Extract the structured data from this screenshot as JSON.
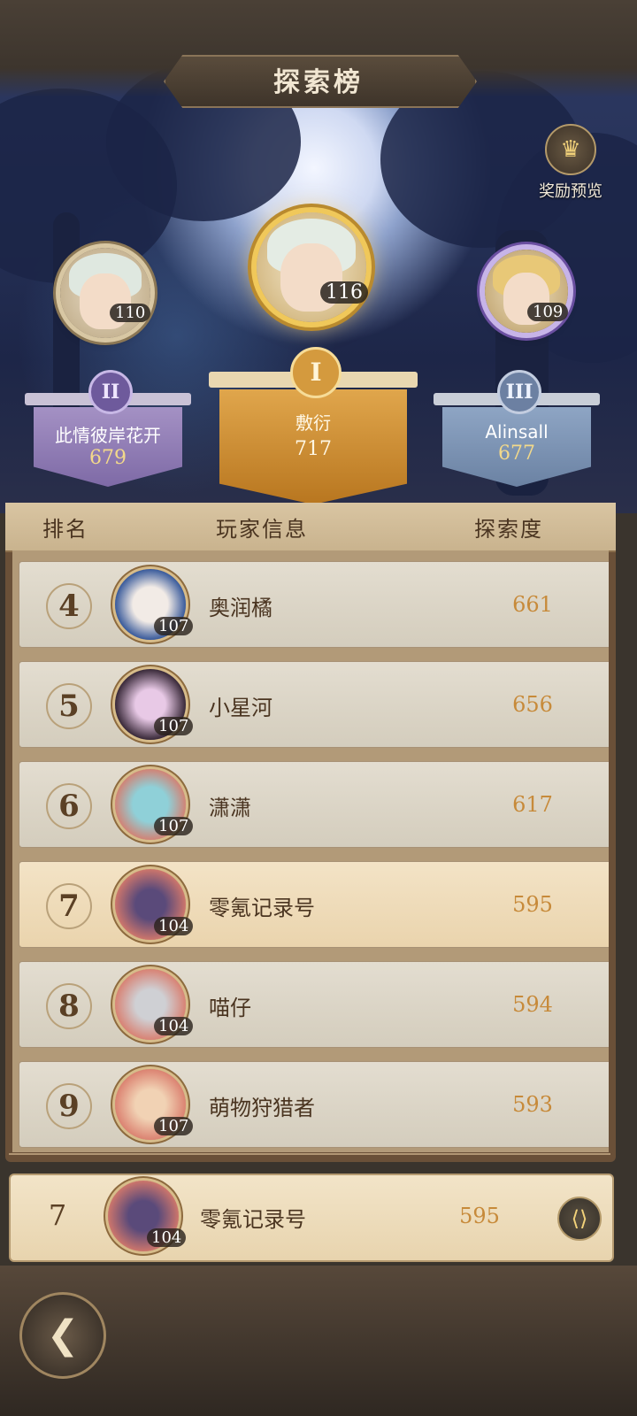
{
  "title": "探索榜",
  "reward_preview": {
    "label": "奖励预览",
    "icon": "reward-chest-icon"
  },
  "top3": [
    {
      "rank": "I",
      "name": "敷衍",
      "score": "717",
      "level": "116"
    },
    {
      "rank": "II",
      "name": "此情彼岸花开",
      "score": "679",
      "level": "110"
    },
    {
      "rank": "III",
      "name": "Alinsall",
      "score": "677",
      "level": "109"
    }
  ],
  "table_header": {
    "rank": "排名",
    "player": "玩家信息",
    "explore": "探索度"
  },
  "rows": [
    {
      "rank": "4",
      "name": "奥润橘",
      "score": "661",
      "level": "107"
    },
    {
      "rank": "5",
      "name": "小星河",
      "score": "656",
      "level": "107"
    },
    {
      "rank": "6",
      "name": "潇潇",
      "score": "617",
      "level": "107"
    },
    {
      "rank": "7",
      "name": "零氪记录号",
      "score": "595",
      "level": "104"
    },
    {
      "rank": "8",
      "name": "喵仔",
      "score": "594",
      "level": "104"
    },
    {
      "rank": "9",
      "name": "萌物狩猎者",
      "score": "593",
      "level": "107"
    }
  ],
  "me": {
    "rank": "7",
    "name": "零氪记录号",
    "score": "595",
    "level": "104",
    "share_icon": "share-icon"
  },
  "back_icon": "back-arrow-icon"
}
